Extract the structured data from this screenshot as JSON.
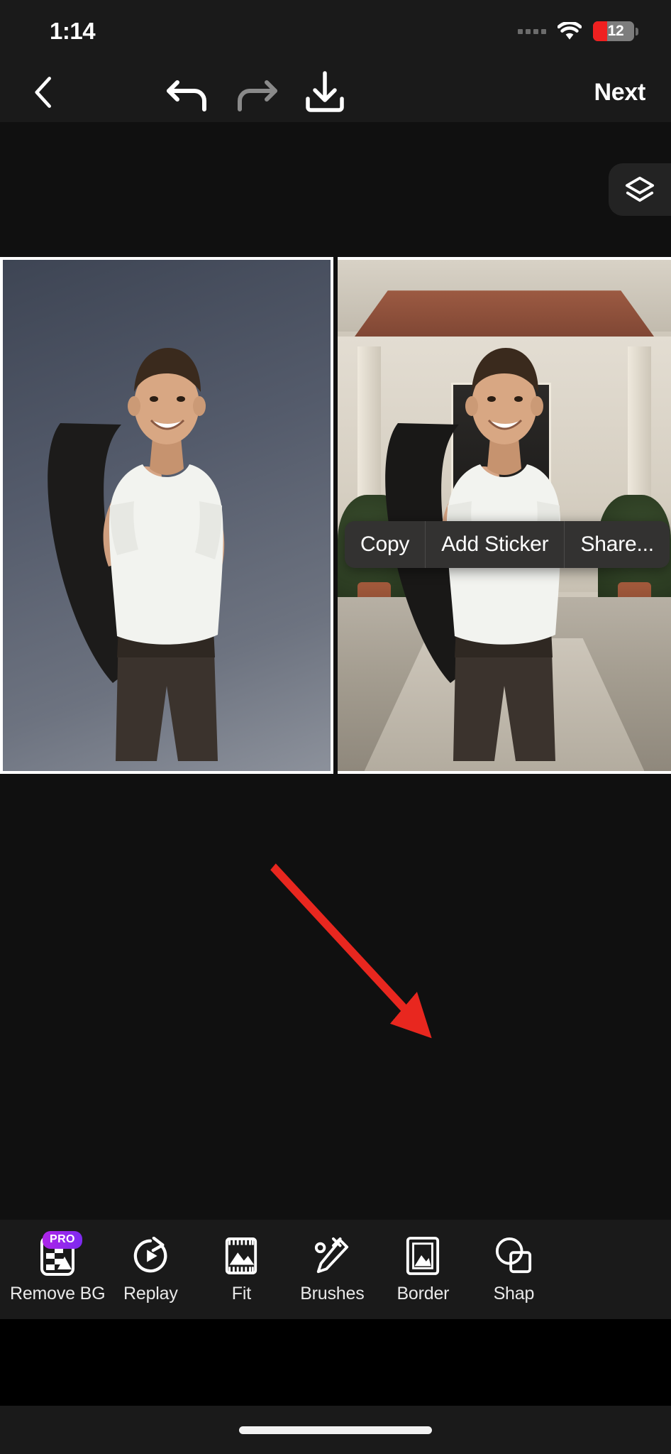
{
  "status_bar": {
    "time": "1:14",
    "battery_level": "12",
    "signal_icon": "signal-dots-icon",
    "wifi_icon": "wifi-icon",
    "battery_icon": "battery-low-icon",
    "battery_low_color": "#f02020"
  },
  "top_toolbar": {
    "back_icon": "chevron-left-icon",
    "undo_icon": "undo-arrow-icon",
    "redo_icon": "redo-arrow-icon",
    "download_icon": "download-icon",
    "next_label": "Next",
    "undo_enabled_color": "#ffffff",
    "redo_disabled_color": "#8a8a8a"
  },
  "canvas": {
    "layers_icon": "layers-icon",
    "left_pane_name": "edited-photo-preview",
    "right_pane_name": "original-photo-preview"
  },
  "context_menu": {
    "items": [
      {
        "label": "Copy",
        "name": "copy-menu-item"
      },
      {
        "label": "Add Sticker",
        "name": "add-sticker-menu-item"
      },
      {
        "label": "Share...",
        "name": "share-menu-item"
      }
    ]
  },
  "bottom_tools": [
    {
      "label": "Remove BG",
      "icon": "remove-background-icon",
      "badge": "PRO"
    },
    {
      "label": "Replay",
      "icon": "replay-icon",
      "badge": ""
    },
    {
      "label": "Fit",
      "icon": "fit-icon",
      "badge": ""
    },
    {
      "label": "Brushes",
      "icon": "brushes-icon",
      "badge": ""
    },
    {
      "label": "Border",
      "icon": "border-icon",
      "badge": ""
    },
    {
      "label": "Shap",
      "icon": "shapes-icon",
      "badge": ""
    }
  ],
  "annotation": {
    "arrow_color": "#e8271f",
    "points_to": "Border"
  },
  "home_indicator": "home-indicator"
}
